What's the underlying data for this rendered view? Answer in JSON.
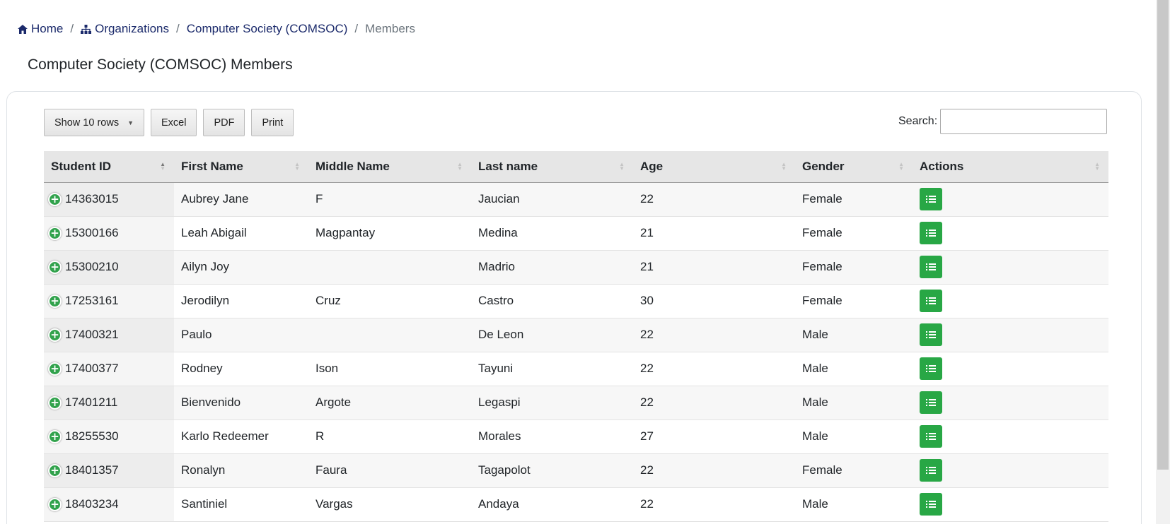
{
  "breadcrumb": {
    "home": "Home",
    "organizations": "Organizations",
    "org": "Computer Society (COMSOC)",
    "current": "Members",
    "separator": "/"
  },
  "page_title": "Computer Society (COMSOC) Members",
  "toolbar": {
    "show_rows": "Show 10 rows",
    "excel": "Excel",
    "pdf": "PDF",
    "print": "Print"
  },
  "search": {
    "label": "Search:",
    "value": ""
  },
  "table": {
    "columns": [
      "Student ID",
      "First Name",
      "Middle Name",
      "Last name",
      "Age",
      "Gender",
      "Actions"
    ],
    "rows": [
      {
        "id": "14363015",
        "first": "Aubrey Jane",
        "middle": "F",
        "last": "Jaucian",
        "age": "22",
        "gender": "Female"
      },
      {
        "id": "15300166",
        "first": "Leah Abigail",
        "middle": "Magpantay",
        "last": "Medina",
        "age": "21",
        "gender": "Female"
      },
      {
        "id": "15300210",
        "first": "Ailyn Joy",
        "middle": "",
        "last": "Madrio",
        "age": "21",
        "gender": "Female"
      },
      {
        "id": "17253161",
        "first": "Jerodilyn",
        "middle": "Cruz",
        "last": "Castro",
        "age": "30",
        "gender": "Female"
      },
      {
        "id": "17400321",
        "first": "Paulo",
        "middle": "",
        "last": "De Leon",
        "age": "22",
        "gender": "Male"
      },
      {
        "id": "17400377",
        "first": "Rodney",
        "middle": "Ison",
        "last": "Tayuni",
        "age": "22",
        "gender": "Male"
      },
      {
        "id": "17401211",
        "first": "Bienvenido",
        "middle": "Argote",
        "last": "Legaspi",
        "age": "22",
        "gender": "Male"
      },
      {
        "id": "18255530",
        "first": "Karlo Redeemer",
        "middle": "R",
        "last": "Morales",
        "age": "27",
        "gender": "Male"
      },
      {
        "id": "18401357",
        "first": "Ronalyn",
        "middle": "Faura",
        "last": "Tagapolot",
        "age": "22",
        "gender": "Female"
      },
      {
        "id": "18403234",
        "first": "Santiniel",
        "middle": "Vargas",
        "last": "Andaya",
        "age": "22",
        "gender": "Male"
      }
    ]
  },
  "colors": {
    "link": "#1b2a6b",
    "action_green": "#28a745",
    "expand_green": "#31a24c"
  },
  "icons": {
    "home": "home-icon",
    "organizations": "sitemap-icon",
    "expand": "plus-circle-icon",
    "action": "list-icon"
  }
}
